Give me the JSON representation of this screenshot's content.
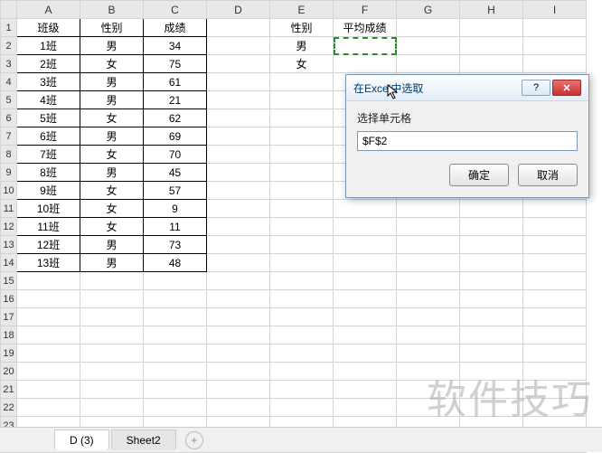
{
  "columns": [
    "A",
    "B",
    "C",
    "D",
    "E",
    "F",
    "G",
    "H",
    "I"
  ],
  "rowCount": 24,
  "table_main": {
    "headers": [
      "班级",
      "性别",
      "成绩"
    ],
    "rows": [
      [
        "1班",
        "男",
        "34"
      ],
      [
        "2班",
        "女",
        "75"
      ],
      [
        "3班",
        "男",
        "61"
      ],
      [
        "4班",
        "男",
        "21"
      ],
      [
        "5班",
        "女",
        "62"
      ],
      [
        "6班",
        "男",
        "69"
      ],
      [
        "7班",
        "女",
        "70"
      ],
      [
        "8班",
        "男",
        "45"
      ],
      [
        "9班",
        "女",
        "57"
      ],
      [
        "10班",
        "女",
        "9"
      ],
      [
        "11班",
        "女",
        "11"
      ],
      [
        "12班",
        "男",
        "73"
      ],
      [
        "13班",
        "男",
        "48"
      ]
    ]
  },
  "side_table": {
    "headers": [
      "性别",
      "平均成绩"
    ],
    "rows": [
      [
        "男",
        ""
      ],
      [
        "女",
        ""
      ]
    ]
  },
  "selected_cell": "F2",
  "dialog": {
    "title": "在Excel中选取",
    "label": "选择单元格",
    "input_value": "$F$2",
    "help": "?",
    "close": "✕",
    "ok": "确定",
    "cancel": "取消"
  },
  "tabs": {
    "active": "D (3)",
    "other": "Sheet2",
    "add": "+"
  },
  "watermark": "软件技巧"
}
